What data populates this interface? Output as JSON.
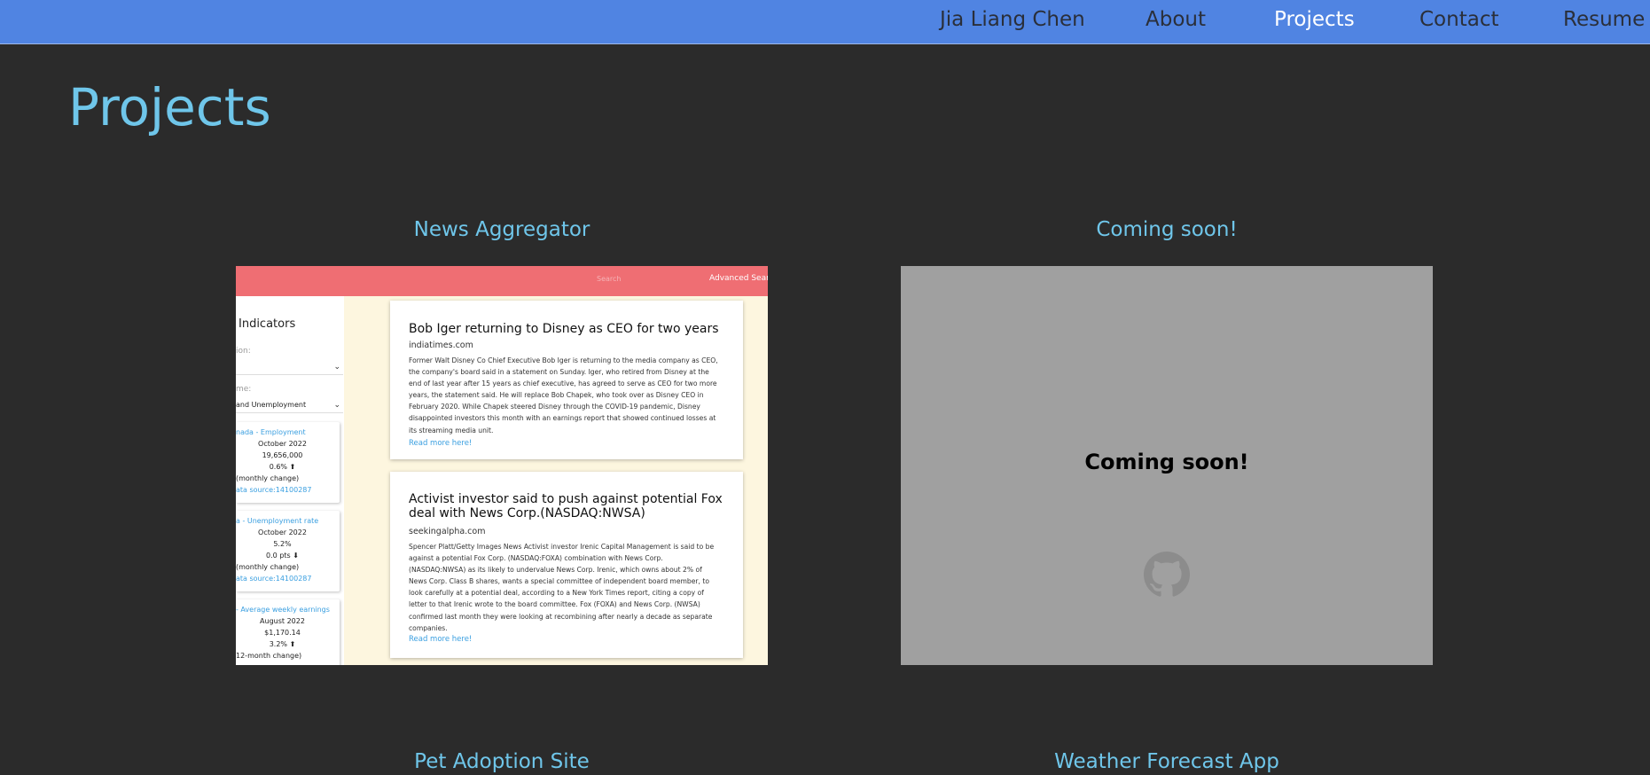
{
  "nav": {
    "items": [
      {
        "label": "Jia Liang Chen",
        "active": false
      },
      {
        "label": "About",
        "active": false
      },
      {
        "label": "Projects",
        "active": true
      },
      {
        "label": "Contact",
        "active": false
      },
      {
        "label": "Resume",
        "active": false
      }
    ]
  },
  "page": {
    "title": "Projects"
  },
  "projects": [
    {
      "title": "News Aggregator",
      "preview": {
        "search_placeholder": "Search",
        "advanced_search": "Advanced Search",
        "sidebar": {
          "title": "Indicators",
          "region_label": "ion:",
          "theme_label": "me:",
          "theme_value": "and Unemployment",
          "cards": [
            {
              "name": "nada - Employment",
              "date": "October 2022",
              "value": "19,656,000",
              "change": "0.6% ⬆",
              "change_note": "(monthly change)",
              "source": "ata source:14100287"
            },
            {
              "name": "a - Unemployment rate",
              "date": "October 2022",
              "value": "5.2%",
              "change": "0.0 pts ⬇",
              "change_note": "(monthly change)",
              "source": "ata source:14100287"
            },
            {
              "name": "- Average weekly earnings",
              "date": "August 2022",
              "value": "$1,170.14",
              "change": "3.2% ⬆",
              "change_note": "12-month change)",
              "source": ""
            }
          ]
        },
        "articles": [
          {
            "title": "Bob Iger returning to Disney as CEO for two years",
            "source": "indiatimes.com",
            "lines": [
              "Former Walt Disney Co Chief Executive Bob Iger is returning to the media company as CEO,",
              "the company's board said in a statement on Sunday. Iger, who retired from Disney at the",
              "end of last year after 15 years as chief executive, has agreed to serve as CEO for two more",
              "years, the statement said. He will replace Bob Chapek, who took over as Disney CEO in",
              "February 2020. While Chapek steered Disney through the COVID-19 pandemic, Disney",
              "disappointed investors this month with an earnings report that showed continued losses at",
              "its streaming media unit."
            ],
            "link": "Read more here!"
          },
          {
            "title": "Activist investor said to push against potential Fox deal with News Corp.(NASDAQ:NWSA)",
            "source": "seekingalpha.com",
            "lines": [
              "Spencer Platt/Getty Images News Activist investor Irenic Capital Management is said to be",
              "against a potential Fox Corp. (NASDAQ:FOXA) combination with News Corp.",
              "(NASDAQ:NWSA) as its likely to undervalue News Corp. Irenic, which owns about 2% of",
              "News Corp. Class B shares, wants a special committee of independent board member, to",
              "look carefully at a potential deal, according to a New York Times report, citing a copy of",
              "letter to that Irenic wrote to the board committee. Fox (FOXA) and News Corp. (NWSA)",
              "confirmed last month they were looking at recombining after nearly a decade as separate",
              "companies."
            ],
            "link": "Read more here!"
          }
        ]
      }
    },
    {
      "title": "Coming soon!",
      "overlay_text": "Coming soon!",
      "icon": "github-icon"
    },
    {
      "title": "Pet Adoption Site"
    },
    {
      "title": "Weather Forecast App"
    }
  ],
  "colors": {
    "nav_bg": "#5084e2",
    "page_bg": "#2b2b2b",
    "accent": "#6fc6ea",
    "preview_header": "#ef6e73",
    "preview_bg": "#fdf6df",
    "placeholder_card": "#a0a0a0"
  }
}
